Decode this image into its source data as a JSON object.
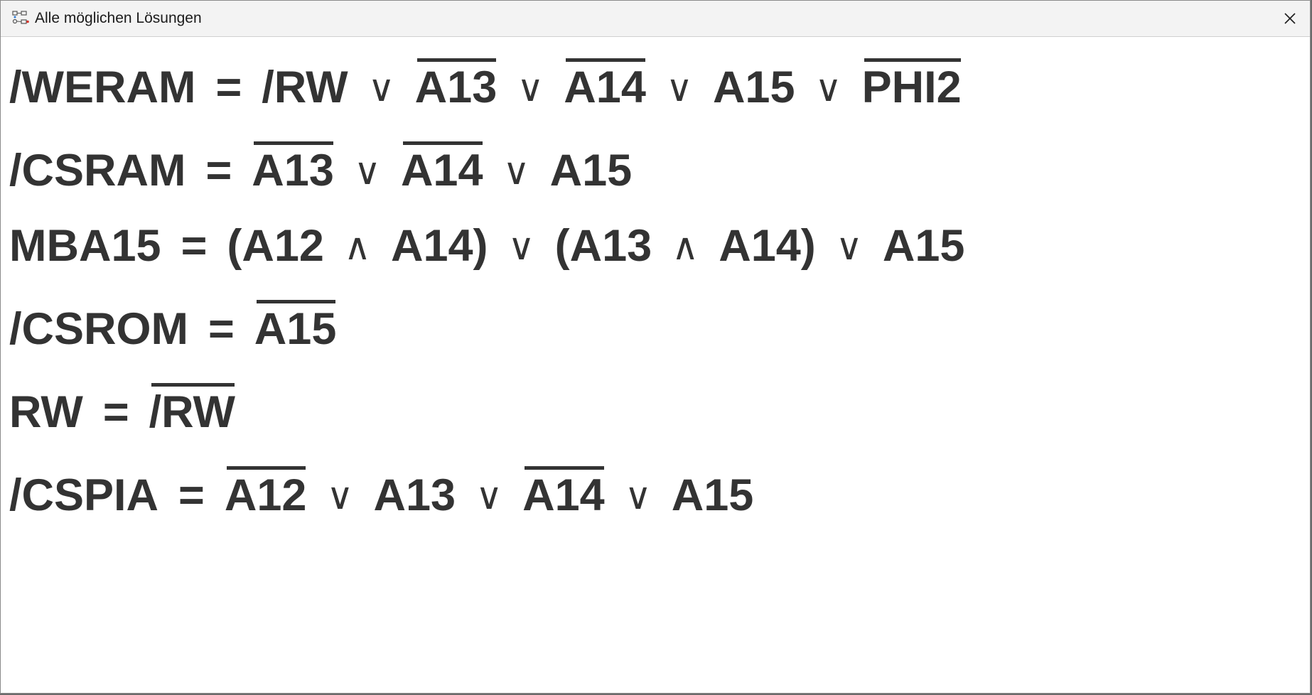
{
  "window": {
    "title": "Alle möglichen Lösungen",
    "icon": "app-logic-icon",
    "close_icon": "close-icon"
  },
  "equations": [
    {
      "tokens": [
        {
          "text": "/WERAM",
          "kind": "var",
          "negated": false
        },
        {
          "text": "=",
          "kind": "eq",
          "negated": false
        },
        {
          "text": "/RW",
          "kind": "var",
          "negated": false
        },
        {
          "text": "∨",
          "kind": "op",
          "negated": false
        },
        {
          "text": "A13",
          "kind": "var",
          "negated": true
        },
        {
          "text": "∨",
          "kind": "op",
          "negated": false
        },
        {
          "text": "A14",
          "kind": "var",
          "negated": true
        },
        {
          "text": "∨",
          "kind": "op",
          "negated": false
        },
        {
          "text": "A15",
          "kind": "var",
          "negated": false
        },
        {
          "text": "∨",
          "kind": "op",
          "negated": false
        },
        {
          "text": "PHI2",
          "kind": "var",
          "negated": true
        }
      ]
    },
    {
      "tokens": [
        {
          "text": "/CSRAM",
          "kind": "var",
          "negated": false
        },
        {
          "text": "=",
          "kind": "eq",
          "negated": false
        },
        {
          "text": "A13",
          "kind": "var",
          "negated": true
        },
        {
          "text": "∨",
          "kind": "op",
          "negated": false
        },
        {
          "text": "A14",
          "kind": "var",
          "negated": true
        },
        {
          "text": "∨",
          "kind": "op",
          "negated": false
        },
        {
          "text": "A15",
          "kind": "var",
          "negated": false
        }
      ]
    },
    {
      "tokens": [
        {
          "text": "MBA15",
          "kind": "var",
          "negated": false
        },
        {
          "text": "=",
          "kind": "eq",
          "negated": false
        },
        {
          "text": "(A12",
          "kind": "var",
          "negated": false
        },
        {
          "text": "∧",
          "kind": "op",
          "negated": false
        },
        {
          "text": "A14)",
          "kind": "var",
          "negated": false
        },
        {
          "text": "∨",
          "kind": "op",
          "negated": false
        },
        {
          "text": "(A13",
          "kind": "var",
          "negated": false
        },
        {
          "text": "∧",
          "kind": "op",
          "negated": false
        },
        {
          "text": "A14)",
          "kind": "var",
          "negated": false
        },
        {
          "text": "∨",
          "kind": "op",
          "negated": false
        },
        {
          "text": "A15",
          "kind": "var",
          "negated": false
        }
      ]
    },
    {
      "tokens": [
        {
          "text": "/CSROM",
          "kind": "var",
          "negated": false
        },
        {
          "text": "=",
          "kind": "eq",
          "negated": false
        },
        {
          "text": "A15",
          "kind": "var",
          "negated": true
        }
      ]
    },
    {
      "tokens": [
        {
          "text": "RW",
          "kind": "var",
          "negated": false
        },
        {
          "text": "=",
          "kind": "eq",
          "negated": false
        },
        {
          "text": "/RW",
          "kind": "var",
          "negated": true
        }
      ]
    },
    {
      "tokens": [
        {
          "text": "/CSPIA",
          "kind": "var",
          "negated": false
        },
        {
          "text": "=",
          "kind": "eq",
          "negated": false
        },
        {
          "text": "A12",
          "kind": "var",
          "negated": true
        },
        {
          "text": "∨",
          "kind": "op",
          "negated": false
        },
        {
          "text": "A13",
          "kind": "var",
          "negated": false
        },
        {
          "text": "∨",
          "kind": "op",
          "negated": false
        },
        {
          "text": "A14",
          "kind": "var",
          "negated": true
        },
        {
          "text": "∨",
          "kind": "op",
          "negated": false
        },
        {
          "text": "A15",
          "kind": "var",
          "negated": false
        }
      ]
    }
  ],
  "colors": {
    "text": "#333333",
    "titlebar": "#f3f3f3",
    "background": "#ffffff"
  }
}
